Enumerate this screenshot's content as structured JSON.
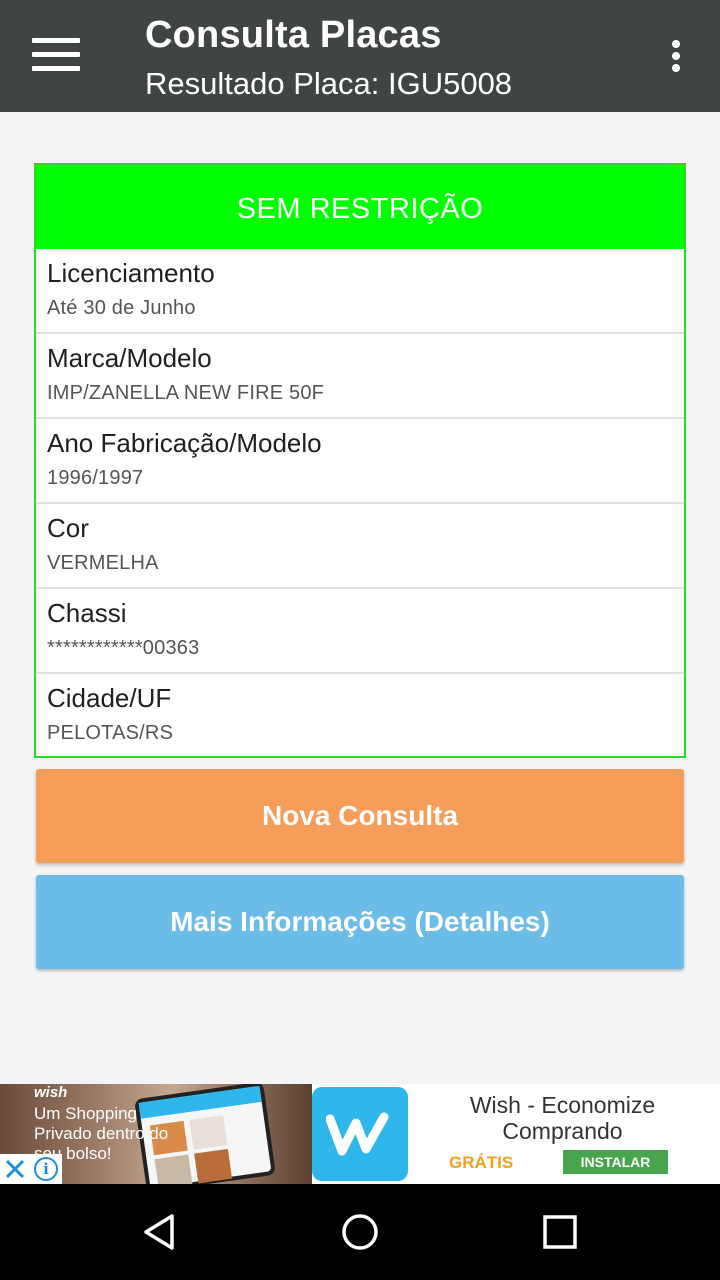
{
  "app_bar": {
    "title": "Consulta Placas",
    "subtitle": "Resultado Placa: IGU5008",
    "background": "#404444"
  },
  "result": {
    "status": "SEM RESTRIÇÃO",
    "status_color": "#00ff00",
    "rows": [
      {
        "label": "Licenciamento",
        "value": "Até 30 de Junho"
      },
      {
        "label": "Marca/Modelo",
        "value": "IMP/ZANELLA NEW FIRE 50F"
      },
      {
        "label": "Ano Fabricação/Modelo",
        "value": "1996/1997"
      },
      {
        "label": "Cor",
        "value": "VERMELHA"
      },
      {
        "label": "Chassi",
        "value": "************00363"
      },
      {
        "label": "Cidade/UF",
        "value": "PELOTAS/RS"
      }
    ]
  },
  "actions": {
    "new_query_label": "Nova Consulta",
    "new_query_color": "#f69d5a",
    "more_info_label": "Mais Informações (Detalhes)",
    "more_info_color": "#6cbce8"
  },
  "ad": {
    "brand": "wish",
    "tagline": "Um Shopping Privado dentro do seu bolso!",
    "title": "Wish - Economize Comprando",
    "price": "GRÁTIS",
    "install_label": "INSTALAR"
  },
  "icons": {
    "menu": "hamburger-menu-icon",
    "overflow": "more-vert-icon",
    "back": "back-triangle-icon",
    "home": "home-circle-icon",
    "recents": "recents-square-icon"
  }
}
